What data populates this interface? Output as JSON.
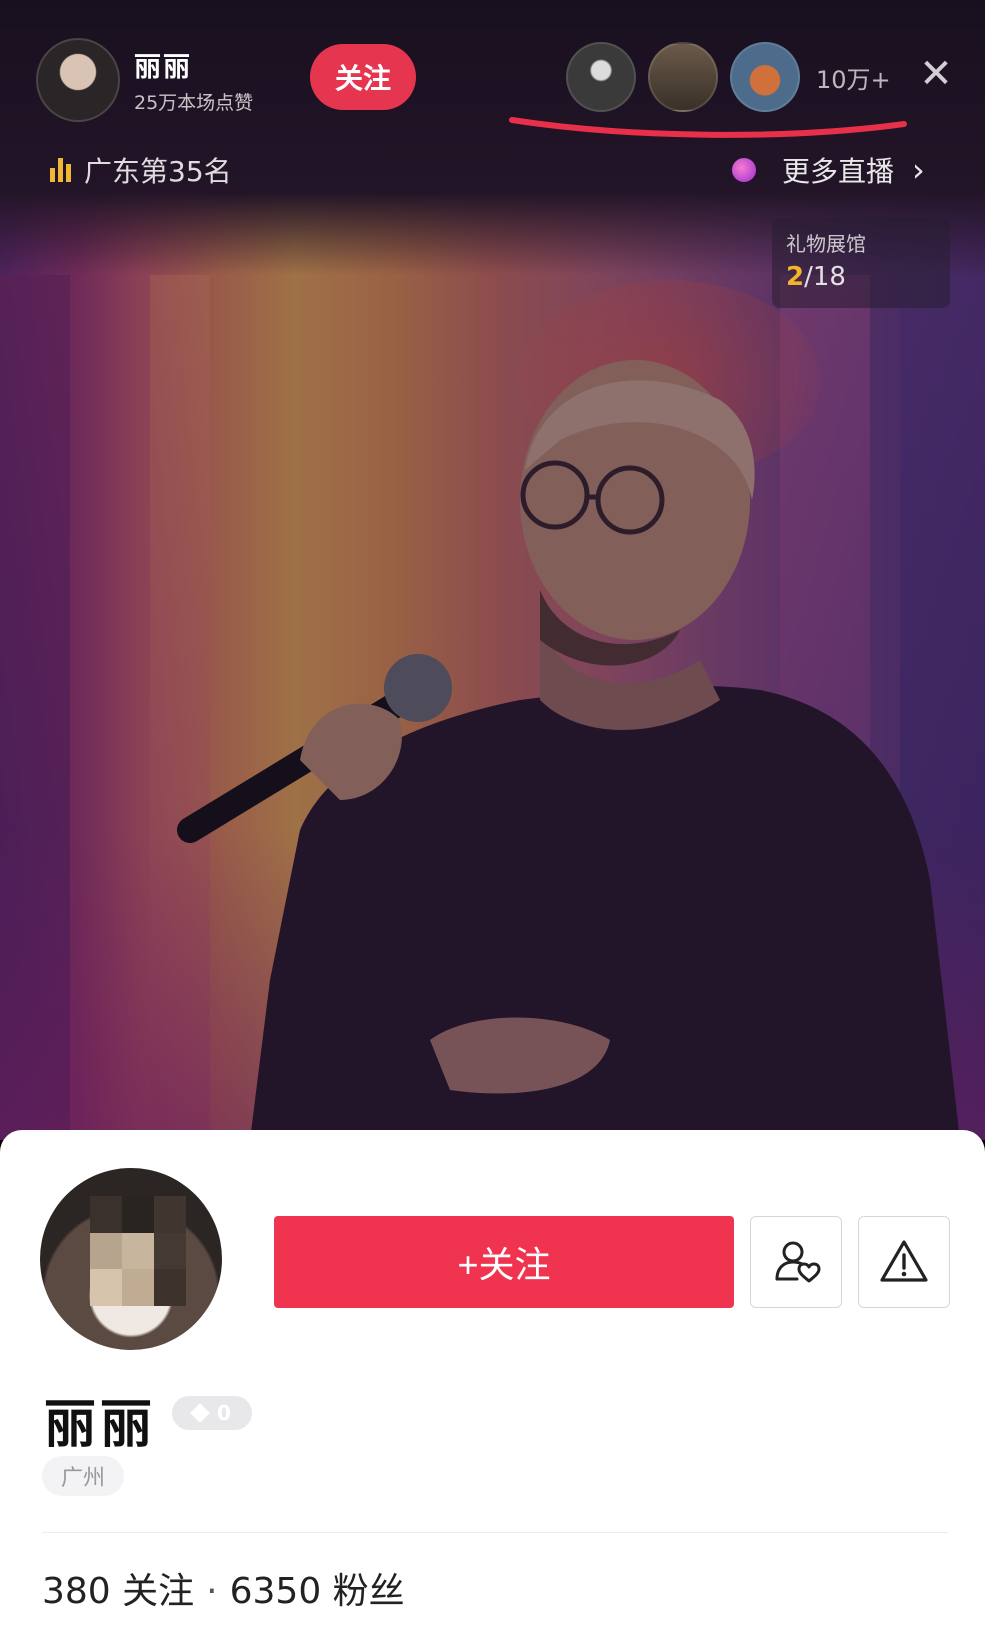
{
  "host": {
    "name": "丽丽",
    "likes": "25万本场点赞",
    "follow_label": "关注"
  },
  "viewers": {
    "count": "10万+"
  },
  "rank": {
    "label": "广东第35名"
  },
  "more_live": {
    "label": "更多直播"
  },
  "gift_hall": {
    "title": "礼物展馆",
    "current": "2",
    "total": "/18"
  },
  "profile": {
    "follow_button": "+关注",
    "name": "丽丽",
    "level": "0",
    "location": "广州",
    "following": "380 关注",
    "separator": "·",
    "followers": "6350 粉丝"
  },
  "colors": {
    "accent": "#f0334f",
    "rank_bars": "#f0b732",
    "annotation": "#e8304a"
  },
  "icons": {
    "close": "close-icon",
    "friend": "user-heart-icon",
    "report": "warning-icon",
    "chevron": "chevron-right-icon"
  }
}
